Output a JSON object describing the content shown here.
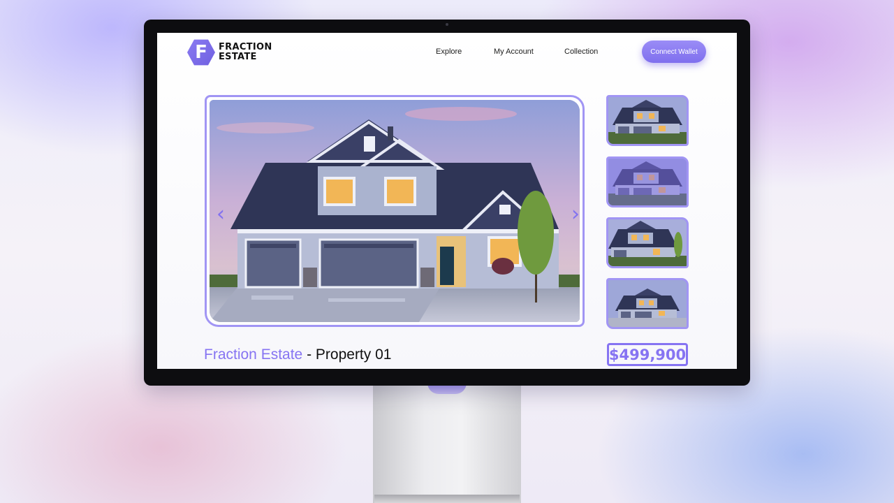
{
  "brand": {
    "logo_letter": "F",
    "name_line1": "FRACTION",
    "name_line2": "ESTATE",
    "accent_color": "#8674f2"
  },
  "nav": {
    "items": [
      {
        "label": "Explore"
      },
      {
        "label": "My Account"
      },
      {
        "label": "Collection"
      }
    ],
    "connect_label": "Connect Wallet"
  },
  "gallery": {
    "prev_icon": "chevron-left-icon",
    "next_icon": "chevron-right-icon",
    "prev_glyph": "‹",
    "next_glyph": "›",
    "thumbnail_count": 4,
    "active_thumbnail": 2
  },
  "property": {
    "brand_part": "Fraction Estate",
    "separator": " - ",
    "name_part": "Property 01",
    "price": "$499,900"
  }
}
